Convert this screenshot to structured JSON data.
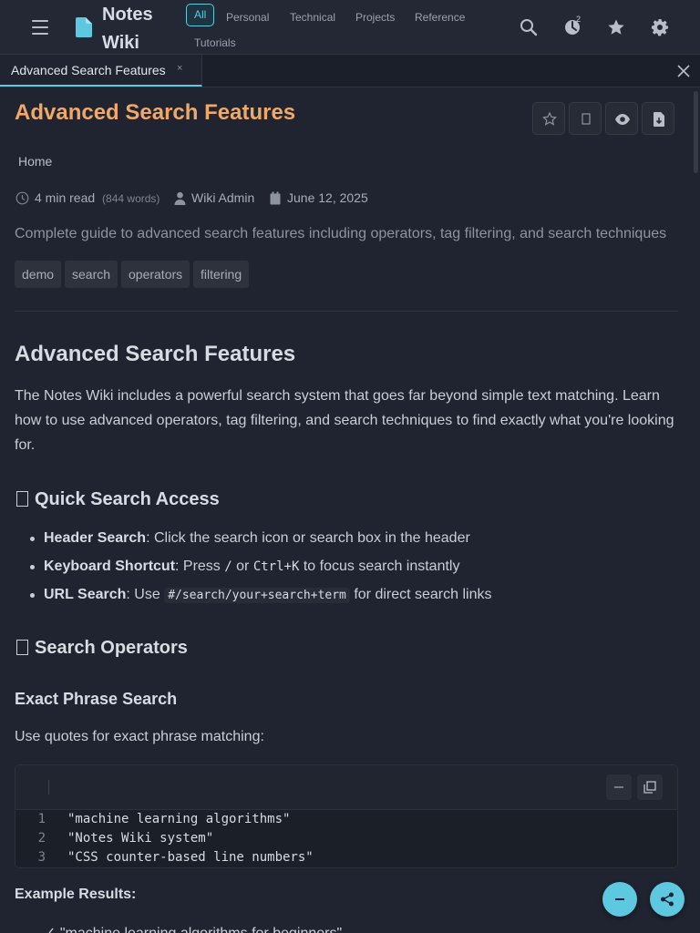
{
  "header": {
    "app_title": "Notes Wiki",
    "nav_tabs": [
      "All",
      "Personal",
      "Technical",
      "Projects",
      "Reference",
      "Tutorials"
    ],
    "active_tab": "All",
    "timer_badge": "2",
    "icons": [
      "menu-icon",
      "search-icon",
      "timer-icon",
      "star-icon",
      "gear-icon"
    ]
  },
  "tabbar": {
    "open_tab": "Advanced Search Features",
    "tab_close": "×"
  },
  "page": {
    "title": "Advanced Search Features",
    "breadcrumb": "Home",
    "meta": {
      "read_time": "4 min read",
      "word_count": "(844 words)",
      "author": "Wiki Admin",
      "date": "June 12, 2025"
    },
    "description": "Complete guide to advanced search features including operators, tag filtering, and search techniques",
    "tags": [
      "demo",
      "search",
      "operators",
      "filtering"
    ]
  },
  "content": {
    "h1": "Advanced Search Features",
    "intro": "The Notes Wiki includes a powerful search system that goes far beyond simple text matching. Learn how to use advanced operators, tag filtering, and search techniques to find exactly what you're looking for.",
    "section1_title": "Quick Search Access",
    "list": [
      {
        "label": "Header Search",
        "text": ": Click the search icon or search box in the header"
      },
      {
        "label": "Keyboard Shortcut",
        "pre": ": Press ",
        "code1": "/",
        "mid": " or ",
        "code2": "Ctrl+K",
        "post": " to focus search instantly"
      },
      {
        "label": "URL Search",
        "pre": ": Use ",
        "code": "#/search/your+search+term",
        "post": " for direct search links"
      }
    ],
    "section2_title": "Search Operators",
    "h3": "Exact Phrase Search",
    "para2": "Use quotes for exact phrase matching:",
    "code_lines": [
      {
        "num": "1",
        "text": "\"machine learning algorithms\""
      },
      {
        "num": "2",
        "text": "\"Notes Wiki system\""
      },
      {
        "num": "3",
        "text": "\"CSS counter-based line numbers\""
      }
    ],
    "h4": "Example Results:",
    "cutoff_line": "✓ \"machine learning algorithms for beginners\""
  },
  "colors": {
    "accent": "#5ec8e0",
    "title": "#f0a868",
    "background": "#1f2430"
  }
}
